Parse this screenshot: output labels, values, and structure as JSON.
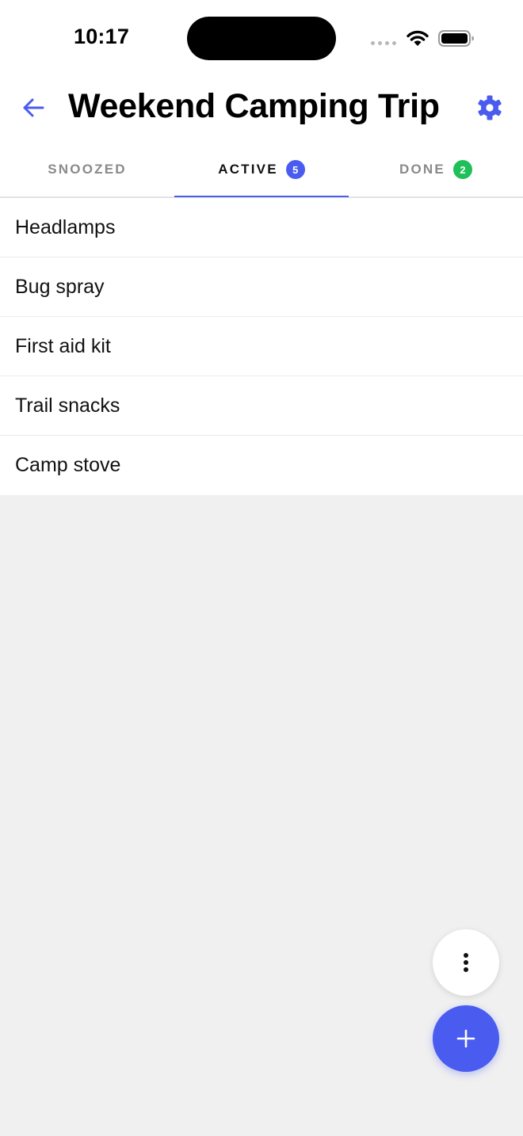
{
  "status_bar": {
    "time": "10:17"
  },
  "header": {
    "title": "Weekend Camping Trip",
    "back_icon": "arrow-left-icon",
    "settings_icon": "gear-icon"
  },
  "tabs": [
    {
      "label": "SNOOZED",
      "badge": null,
      "active": false
    },
    {
      "label": "ACTIVE",
      "badge": "5",
      "badge_color": "#4a5cf0",
      "active": true
    },
    {
      "label": "DONE",
      "badge": "2",
      "badge_color": "#1fbf5a",
      "active": false
    }
  ],
  "items": [
    {
      "label": "Headlamps"
    },
    {
      "label": "Bug spray"
    },
    {
      "label": "First aid kit"
    },
    {
      "label": "Trail snacks"
    },
    {
      "label": "Camp stove"
    }
  ],
  "fabs": {
    "more_icon": "more-vertical-icon",
    "add_icon": "plus-icon"
  },
  "colors": {
    "accent": "#4a5cf0",
    "done_badge": "#1fbf5a",
    "background": "#f0f0f0"
  }
}
